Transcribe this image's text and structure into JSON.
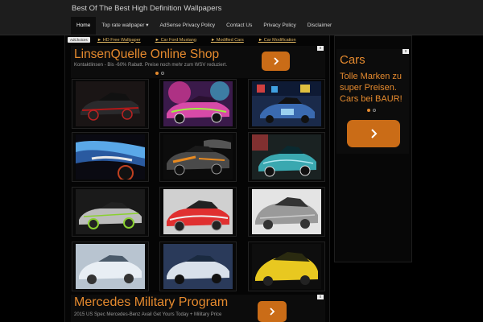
{
  "header": {
    "site_title": "Best Of The Best High Definition Wallpapers",
    "nav": [
      {
        "label": "Home"
      },
      {
        "label": "Top rate wallpaper ▾"
      },
      {
        "label": "AdSense Privacy Policy"
      },
      {
        "label": "Contact Us"
      },
      {
        "label": "Privacy Policy"
      },
      {
        "label": "Disclaimer"
      }
    ]
  },
  "ad_links": {
    "adchoices": "AdChoices",
    "links": [
      "► HD Free Wallpaper",
      "► Car Ford Mustang",
      "► Modified Cars",
      "► Car Modification"
    ]
  },
  "ad_top": {
    "title": "LinsenQuelle Online Shop",
    "subtitle": "Kontaktlinsen - Bis -60% Rabatt. Preise noch mehr zum WSV reduziert.",
    "close": "x"
  },
  "ad_right": {
    "title": "Cars",
    "text": "Tolle Marken zu super Preisen. Cars bei BAUR!",
    "close": "x"
  },
  "ad_bottom": {
    "title": "Mercedes Military Program",
    "subtitle": "2015 US Spec Mercedes-Benz Avail Get Yours Today + Military Price",
    "close": "x"
  },
  "icons": {
    "ad_arrow": "chevron-right-icon",
    "thumbnail": "car-wallpaper-image"
  },
  "colors": {
    "accent_orange": "#e58a2e",
    "button_orange": "#ca6c17",
    "link_gold": "#e2b864",
    "header_bg": "#1d1d1d"
  }
}
